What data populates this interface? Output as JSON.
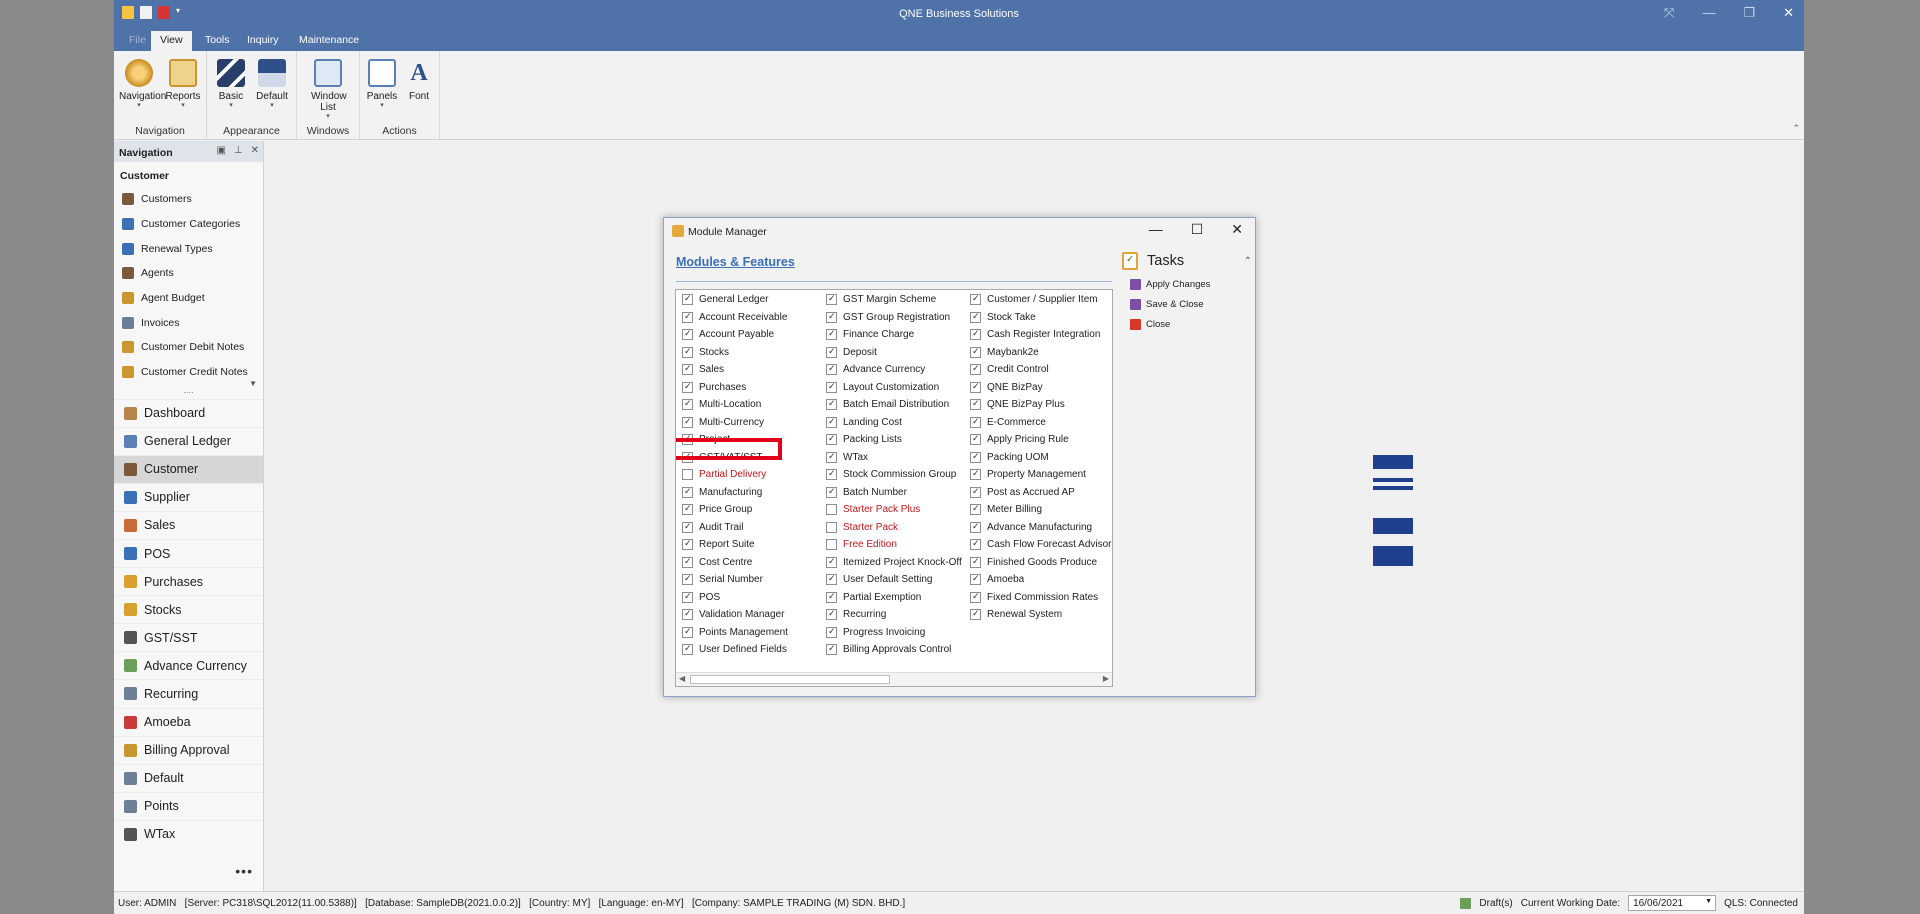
{
  "window": {
    "title": "QNE Business Solutions"
  },
  "ribbon_tabs": [
    "File",
    "View",
    "Tools",
    "Inquiry",
    "Maintenance"
  ],
  "ribbon": {
    "groups": [
      {
        "label": "Navigation",
        "buttons": [
          "Navigation",
          "Reports"
        ]
      },
      {
        "label": "Appearance",
        "buttons": [
          "Basic",
          "Default"
        ]
      },
      {
        "label": "Windows",
        "buttons": [
          "Window List"
        ]
      },
      {
        "label": "Actions",
        "buttons": [
          "Panels",
          "Font"
        ]
      }
    ]
  },
  "nav": {
    "header": "Navigation",
    "section": "Customer",
    "items": [
      "Customers",
      "Customer Categories",
      "Renewal Types",
      "Agents",
      "Agent Budget",
      "Invoices",
      "Customer Debit Notes",
      "Customer Credit Notes"
    ],
    "more": "....",
    "modules": [
      "Dashboard",
      "General Ledger",
      "Customer",
      "Supplier",
      "Sales",
      "POS",
      "Purchases",
      "Stocks",
      "GST/SST",
      "Advance Currency",
      "Recurring",
      "Amoeba",
      "Billing Approval",
      "Default",
      "Points",
      "WTax"
    ],
    "active_module": "Customer",
    "dots": "•••"
  },
  "dialog": {
    "title": "Module Manager",
    "section_title": "Modules & Features",
    "columns": [
      [
        {
          "label": "General Ledger",
          "checked": true,
          "red": false
        },
        {
          "label": "Account Receivable",
          "checked": true,
          "red": false
        },
        {
          "label": "Account Payable",
          "checked": true,
          "red": false
        },
        {
          "label": "Stocks",
          "checked": true,
          "red": false
        },
        {
          "label": "Sales",
          "checked": true,
          "red": false
        },
        {
          "label": "Purchases",
          "checked": true,
          "red": false
        },
        {
          "label": "Multi-Location",
          "checked": true,
          "red": false
        },
        {
          "label": "Multi-Currency",
          "checked": true,
          "red": false
        },
        {
          "label": "Project",
          "checked": true,
          "red": false
        },
        {
          "label": "GST/VAT/SST",
          "checked": true,
          "red": false
        },
        {
          "label": "Partial Delivery",
          "checked": false,
          "red": true
        },
        {
          "label": "Manufacturing",
          "checked": true,
          "red": false
        },
        {
          "label": "Price Group",
          "checked": true,
          "red": false
        },
        {
          "label": "Audit Trail",
          "checked": true,
          "red": false
        },
        {
          "label": "Report Suite",
          "checked": true,
          "red": false
        },
        {
          "label": "Cost Centre",
          "checked": true,
          "red": false
        },
        {
          "label": "Serial Number",
          "checked": true,
          "red": false
        },
        {
          "label": "POS",
          "checked": true,
          "red": false
        },
        {
          "label": "Validation Manager",
          "checked": true,
          "red": false
        },
        {
          "label": "Points Management",
          "checked": true,
          "red": false
        },
        {
          "label": "User Defined Fields",
          "checked": true,
          "red": false
        }
      ],
      [
        {
          "label": "GST Margin Scheme",
          "checked": true,
          "red": false
        },
        {
          "label": "GST Group Registration",
          "checked": true,
          "red": false
        },
        {
          "label": "Finance Charge",
          "checked": true,
          "red": false
        },
        {
          "label": "Deposit",
          "checked": true,
          "red": false
        },
        {
          "label": "Advance Currency",
          "checked": true,
          "red": false
        },
        {
          "label": "Layout Customization",
          "checked": true,
          "red": false
        },
        {
          "label": "Batch Email Distribution",
          "checked": true,
          "red": false
        },
        {
          "label": "Landing Cost",
          "checked": true,
          "red": false
        },
        {
          "label": "Packing Lists",
          "checked": true,
          "red": false
        },
        {
          "label": "WTax",
          "checked": true,
          "red": false
        },
        {
          "label": "Stock Commission Group",
          "checked": true,
          "red": false
        },
        {
          "label": "Batch Number",
          "checked": true,
          "red": false
        },
        {
          "label": "Starter Pack Plus",
          "checked": false,
          "red": true
        },
        {
          "label": "Starter Pack",
          "checked": false,
          "red": true
        },
        {
          "label": "Free Edition",
          "checked": false,
          "red": true
        },
        {
          "label": "Itemized Project Knock-Off",
          "checked": true,
          "red": false
        },
        {
          "label": "User Default Setting",
          "checked": true,
          "red": false
        },
        {
          "label": "Partial Exemption",
          "checked": true,
          "red": false
        },
        {
          "label": "Recurring",
          "checked": true,
          "red": false
        },
        {
          "label": "Progress Invoicing",
          "checked": true,
          "red": false
        },
        {
          "label": "Billing Approvals Control",
          "checked": true,
          "red": false
        }
      ],
      [
        {
          "label": "Customer / Supplier Item",
          "checked": true,
          "red": false
        },
        {
          "label": "Stock Take",
          "checked": true,
          "red": false
        },
        {
          "label": "Cash Register Integration",
          "checked": true,
          "red": false
        },
        {
          "label": "Maybank2e",
          "checked": true,
          "red": false
        },
        {
          "label": "Credit Control",
          "checked": true,
          "red": false
        },
        {
          "label": "QNE BizPay",
          "checked": true,
          "red": false
        },
        {
          "label": "QNE BizPay Plus",
          "checked": true,
          "red": false
        },
        {
          "label": "E-Commerce",
          "checked": true,
          "red": false
        },
        {
          "label": "Apply Pricing Rule",
          "checked": true,
          "red": false
        },
        {
          "label": "Packing UOM",
          "checked": true,
          "red": false
        },
        {
          "label": "Property Management",
          "checked": true,
          "red": false
        },
        {
          "label": "Post as Accrued AP",
          "checked": true,
          "red": false
        },
        {
          "label": "Meter Billing",
          "checked": true,
          "red": false
        },
        {
          "label": "Advance Manufacturing",
          "checked": true,
          "red": false
        },
        {
          "label": "Cash Flow Forecast Advisor",
          "checked": true,
          "red": false
        },
        {
          "label": "Finished Goods Produce",
          "checked": true,
          "red": false
        },
        {
          "label": "Amoeba",
          "checked": true,
          "red": false
        },
        {
          "label": "Fixed Commission Rates",
          "checked": true,
          "red": false
        },
        {
          "label": "Renewal System",
          "checked": true,
          "red": false
        }
      ]
    ],
    "tasks": {
      "title": "Tasks",
      "items": [
        "Apply Changes",
        "Save & Close",
        "Close"
      ]
    }
  },
  "status": {
    "left": "User: ADMIN   [Server: PC318\\SQL2012(11.00.5388)]   [Database: SampleDB(2021.0.0.2)]   [Country: MY]   [Language: en-MY]   [Company: SAMPLE TRADING (M) SDN. BHD.]",
    "drafts": "Draft(s)",
    "date_label": "Current Working Date:",
    "date_value": "16/06/2021",
    "qls": "QLS: Connected"
  },
  "colors": {
    "title_bar": "#4f73a9",
    "highlight": "#e3001b",
    "link": "#3b6fb6",
    "logo": "#1f3f8f"
  }
}
